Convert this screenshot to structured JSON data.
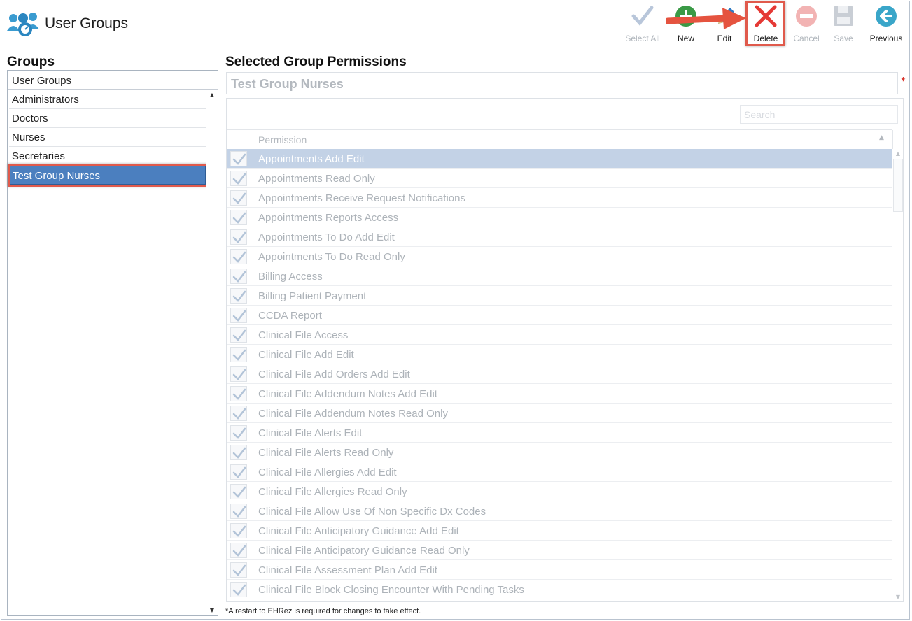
{
  "app": {
    "title": "User Groups",
    "logo_icon": "users-icon"
  },
  "toolbar": {
    "select_all": {
      "label": "Select All",
      "icon": "checkmark-icon",
      "enabled": false
    },
    "new": {
      "label": "New",
      "icon": "plus-circle-icon",
      "enabled": true
    },
    "edit": {
      "label": "Edit",
      "icon": "pencil-icon",
      "enabled": true
    },
    "delete": {
      "label": "Delete",
      "icon": "x-icon",
      "enabled": true,
      "highlighted": true
    },
    "cancel": {
      "label": "Cancel",
      "icon": "minus-circle-icon",
      "enabled": false
    },
    "save": {
      "label": "Save",
      "icon": "floppy-disk-icon",
      "enabled": false
    },
    "previous": {
      "label": "Previous",
      "icon": "arrow-left-circle-icon",
      "enabled": true
    }
  },
  "groups": {
    "heading": "Groups",
    "column_header": "User Groups",
    "items": [
      {
        "label": "Administrators",
        "selected": false
      },
      {
        "label": "Doctors",
        "selected": false
      },
      {
        "label": "Nurses",
        "selected": false
      },
      {
        "label": "Secretaries",
        "selected": false
      },
      {
        "label": "Test Group Nurses",
        "selected": true
      }
    ]
  },
  "permissions": {
    "heading": "Selected Group Permissions",
    "group_name": "Test Group Nurses",
    "required_mark": "*",
    "search_placeholder": "Search",
    "column_header": "Permission",
    "rows": [
      {
        "label": "Appointments Add Edit",
        "checked": true,
        "selected": true
      },
      {
        "label": "Appointments Read Only",
        "checked": true
      },
      {
        "label": "Appointments Receive Request Notifications",
        "checked": true
      },
      {
        "label": "Appointments Reports Access",
        "checked": true
      },
      {
        "label": "Appointments To Do Add Edit",
        "checked": true
      },
      {
        "label": "Appointments To Do Read Only",
        "checked": true
      },
      {
        "label": "Billing Access",
        "checked": true
      },
      {
        "label": "Billing Patient Payment",
        "checked": true
      },
      {
        "label": "CCDA Report",
        "checked": true
      },
      {
        "label": "Clinical File Access",
        "checked": true
      },
      {
        "label": "Clinical File Add Edit",
        "checked": true
      },
      {
        "label": "Clinical File Add Orders Add Edit",
        "checked": true
      },
      {
        "label": "Clinical File Addendum Notes Add Edit",
        "checked": true
      },
      {
        "label": "Clinical File Addendum Notes Read Only",
        "checked": true
      },
      {
        "label": "Clinical File Alerts Edit",
        "checked": true
      },
      {
        "label": "Clinical File Alerts Read Only",
        "checked": true
      },
      {
        "label": "Clinical File Allergies Add Edit",
        "checked": true
      },
      {
        "label": "Clinical File Allergies Read Only",
        "checked": true
      },
      {
        "label": "Clinical File Allow Use Of Non Specific Dx Codes",
        "checked": true
      },
      {
        "label": "Clinical File Anticipatory Guidance Add Edit",
        "checked": true
      },
      {
        "label": "Clinical File Anticipatory Guidance Read Only",
        "checked": true
      },
      {
        "label": "Clinical File Assessment Plan Add Edit",
        "checked": true
      },
      {
        "label": "Clinical File Block Closing Encounter With Pending Tasks",
        "checked": true
      }
    ]
  },
  "footer": {
    "note": "*A restart to EHRez is required for changes to take effect."
  },
  "colors": {
    "selected_row": "#4b7fbf",
    "highlight_outline": "#e05a4c",
    "new_icon": "#3a9a46",
    "delete_icon": "#e53935",
    "previous_icon": "#3aa6c9"
  }
}
